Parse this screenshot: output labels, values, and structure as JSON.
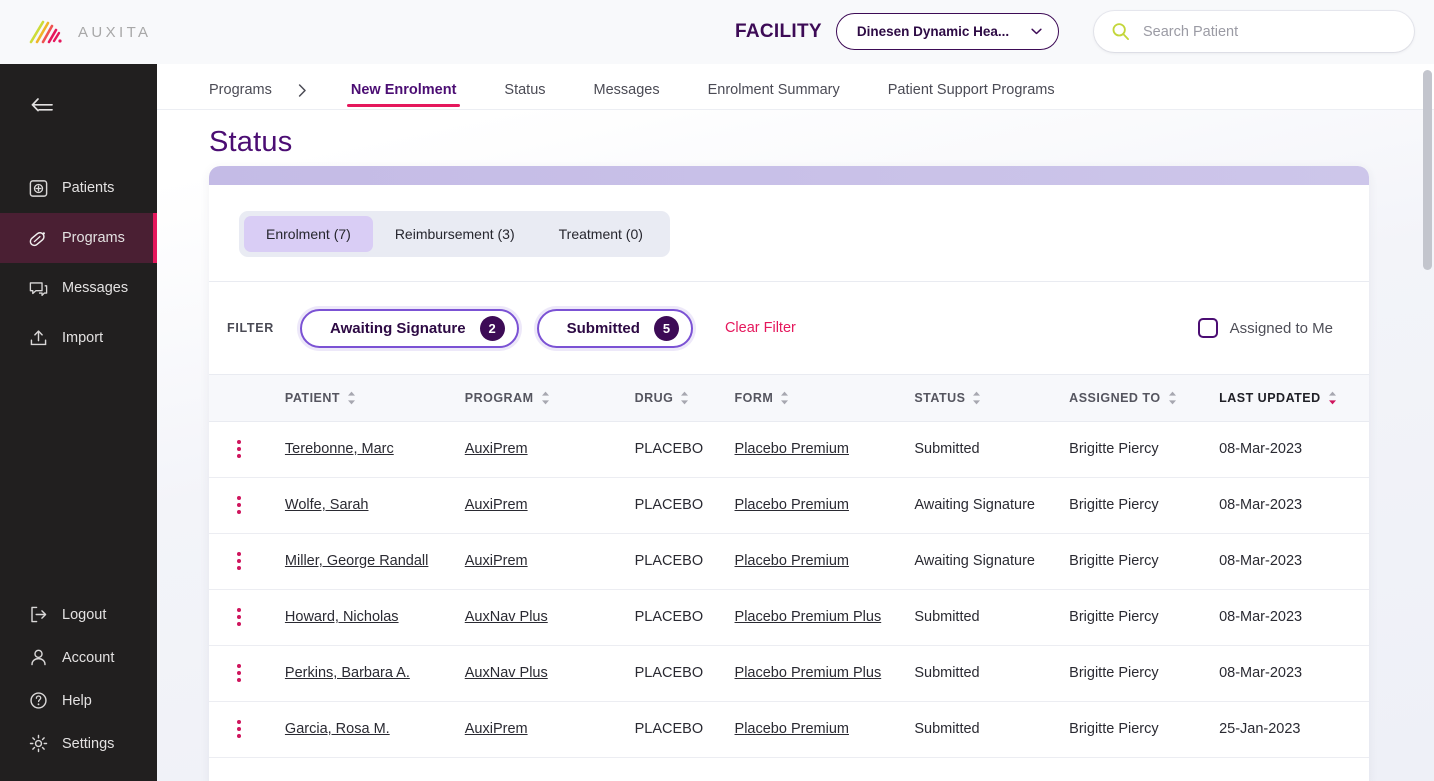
{
  "header": {
    "logo_text": "AUXITA",
    "logo_icon": "auxita-slashes-logo",
    "facility_label": "FACILITY",
    "facility_value": "Dinesen Dynamic Hea...",
    "facility_chevron_icon": "chevron-down-icon",
    "search_icon": "search-icon",
    "search_placeholder": "Search Patient",
    "search_value": ""
  },
  "sidebar": {
    "collapse_icon": "collapse-sidebar-icon",
    "items": [
      {
        "label": "Patients",
        "icon": "patients-icon",
        "active": false
      },
      {
        "label": "Programs",
        "icon": "programs-pill-icon",
        "active": true
      },
      {
        "label": "Messages",
        "icon": "messages-icon",
        "active": false
      },
      {
        "label": "Import",
        "icon": "import-upload-icon",
        "active": false
      }
    ],
    "bottom_items": [
      {
        "label": "Logout",
        "icon": "logout-icon"
      },
      {
        "label": "Account",
        "icon": "account-person-icon"
      },
      {
        "label": "Help",
        "icon": "help-question-icon"
      },
      {
        "label": "Settings",
        "icon": "settings-gear-icon"
      }
    ]
  },
  "tabs": {
    "breadcrumb": "Programs",
    "breadcrumb_chevron_icon": "chevron-right-icon",
    "items": [
      {
        "label": "New Enrolment",
        "active": true
      },
      {
        "label": "Status",
        "active": false
      },
      {
        "label": "Messages",
        "active": false
      },
      {
        "label": "Enrolment Summary",
        "active": false
      },
      {
        "label": "Patient Support Programs",
        "active": false
      }
    ]
  },
  "page": {
    "title": "Status"
  },
  "segmented": {
    "options": [
      {
        "label": "Enrolment (7)",
        "active": true
      },
      {
        "label": "Reimbursement (3)",
        "active": false
      },
      {
        "label": "Treatment (0)",
        "active": false
      }
    ]
  },
  "filters": {
    "label": "FILTER",
    "pills": [
      {
        "label": "Awaiting Signature",
        "count": "2"
      },
      {
        "label": "Submitted",
        "count": "5"
      }
    ],
    "clear_label": "Clear Filter",
    "assigned_label": "Assigned to Me",
    "assigned_checked": false
  },
  "table": {
    "columns": [
      {
        "label": "PATIENT",
        "sorted": false
      },
      {
        "label": "PROGRAM",
        "sorted": false
      },
      {
        "label": "DRUG",
        "sorted": false
      },
      {
        "label": "FORM",
        "sorted": false
      },
      {
        "label": "STATUS",
        "sorted": false
      },
      {
        "label": "ASSIGNED TO",
        "sorted": false
      },
      {
        "label": "LAST UPDATED",
        "sorted": true
      }
    ],
    "rows": [
      {
        "patient": "Terebonne, Marc",
        "program": "AuxiPrem",
        "drug": "PLACEBO",
        "form": "Placebo Premium",
        "status": "Submitted",
        "assigned": "Brigitte Piercy",
        "updated": "08-Mar-2023"
      },
      {
        "patient": "Wolfe, Sarah",
        "program": "AuxiPrem",
        "drug": "PLACEBO",
        "form": "Placebo Premium",
        "status": "Awaiting Signature",
        "assigned": "Brigitte Piercy",
        "updated": "08-Mar-2023"
      },
      {
        "patient": "Miller, George Randall",
        "program": "AuxiPrem",
        "drug": "PLACEBO",
        "form": "Placebo Premium",
        "status": "Awaiting Signature",
        "assigned": "Brigitte Piercy",
        "updated": "08-Mar-2023"
      },
      {
        "patient": "Howard, Nicholas",
        "program": "AuxNav Plus",
        "drug": "PLACEBO",
        "form": "Placebo Premium Plus",
        "status": "Submitted",
        "assigned": "Brigitte Piercy",
        "updated": "08-Mar-2023"
      },
      {
        "patient": "Perkins, Barbara A.",
        "program": "AuxNav Plus",
        "drug": "PLACEBO",
        "form": "Placebo Premium Plus",
        "status": "Submitted",
        "assigned": "Brigitte Piercy",
        "updated": "08-Mar-2023"
      },
      {
        "patient": "Garcia, Rosa M.",
        "program": "AuxiPrem",
        "drug": "PLACEBO",
        "form": "Placebo Premium",
        "status": "Submitted",
        "assigned": "Brigitte Piercy",
        "updated": "25-Jan-2023"
      }
    ],
    "row_menu_icon": "kebab-menu-icon",
    "sort_icon": "sort-arrows-icon"
  },
  "colors": {
    "brand_purple": "#4b0d73",
    "deep_purple": "#3d0b56",
    "accent_pink": "#e5175c",
    "sidebar_bg": "#211f1f",
    "sidebar_active_bg": "#4a1f33",
    "card_strip": "#c6bde7",
    "segment_active": "#d9cdf5",
    "pill_border": "#7b52d4",
    "logo_lime": "#c8d62e"
  }
}
